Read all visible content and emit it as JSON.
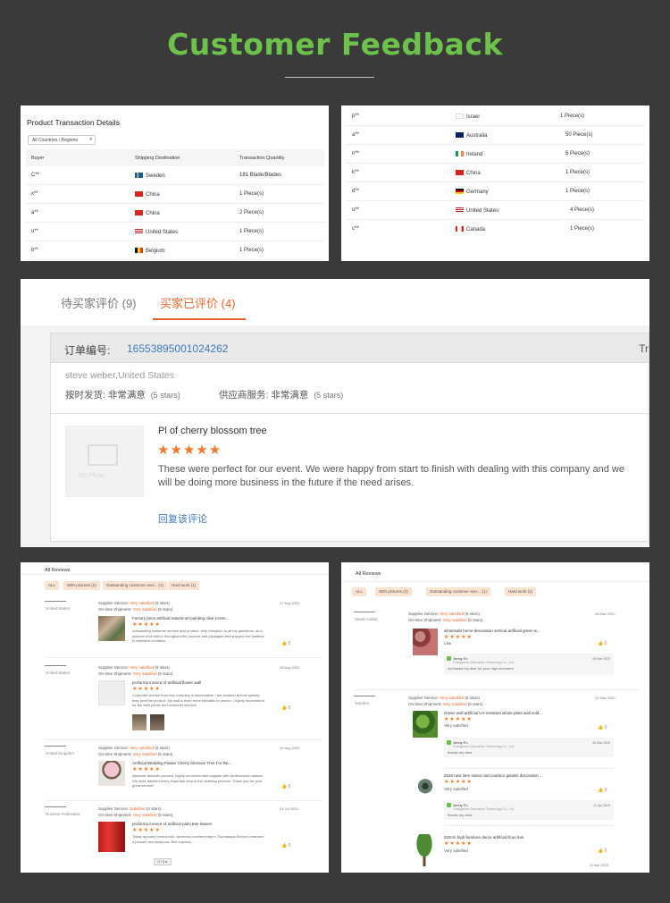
{
  "page": {
    "title": "Customer Feedback"
  },
  "transactions_left": {
    "title": "Product Transaction Details",
    "filter": "All Countries / Regions",
    "columns": [
      "Buyer",
      "Shipping Destination",
      "Transaction Quantity"
    ],
    "rows": [
      {
        "buyer": "C**",
        "country": "Sweden",
        "qty": "181 Blade/Blades"
      },
      {
        "buyer": "x**",
        "country": "China",
        "qty": "1 Piece(s)"
      },
      {
        "buyer": "a**",
        "country": "China",
        "qty": "2 Piece(s)"
      },
      {
        "buyer": "u**",
        "country": "United States",
        "qty": "1 Piece(s)"
      },
      {
        "buyer": "b**",
        "country": "Belgium",
        "qty": "1 Piece(s)"
      }
    ]
  },
  "transactions_right": {
    "rows": [
      {
        "buyer": "p**",
        "country": "Israel",
        "qty": "1 Piece(s)"
      },
      {
        "buyer": "a**",
        "country": "Australia",
        "qty": "50 Piece(s)"
      },
      {
        "buyer": "n**",
        "country": "Ireland",
        "qty": "5 Piece(s)"
      },
      {
        "buyer": "k**",
        "country": "China",
        "qty": "1 Piece(s)"
      },
      {
        "buyer": "d**",
        "country": "Germany",
        "qty": "1 Piece(s)"
      },
      {
        "buyer": "u**",
        "country": "United States",
        "qty": "4 Piece(s)"
      },
      {
        "buyer": "c**",
        "country": "Canada",
        "qty": "1 Piece(s)"
      }
    ]
  },
  "review_panel": {
    "tab_pending": "待买家评价 (9)",
    "tab_done": "买家已评价 (4)",
    "order_label": "订单编号:",
    "order_id": "16553895001024262",
    "order_right": "Tr",
    "buyer": "steve weber,United States",
    "ship_label": "按时发货: 非常满意",
    "ship_stars": "(5 stars)",
    "service_label": "供应商服务: 非常满意",
    "service_stars": "(5 stars)",
    "no_photo": "No Photo",
    "product": "Pl of cherry blossom tree",
    "stars": "★★★★★",
    "text": "These were perfect for our event. We were happy from start to finish with dealing with this company and we will be doing more business in the future if the need arises.",
    "reply_link": "回复该评论"
  },
  "reviews_left": {
    "title": "All Reviews",
    "chips": [
      "ALL",
      "With pictures (2)",
      "Outstanding customer serv... (1)",
      "Hard work (1)"
    ],
    "items": [
      {
        "user": "United States",
        "svc": "Supplier Service:",
        "svc_v": "Very satisfied",
        "svc_s": "(5 stars)",
        "ship": "On-time Shipment:",
        "ship_v": "Very satisfied",
        "ship_s": "(5 stars)",
        "date": "27 Aug 2020",
        "product": "Factory price artificial natural art painting olive Cress...",
        "stars": "★★★★★",
        "text": "outstanding customer service and product. very reception to all my questions, as in pictures and videos throughout the process and packages and shipped the material in excellent condition.",
        "likes": "0"
      },
      {
        "user": "United States",
        "svc": "Supplier Service:",
        "svc_v": "Very satisfied",
        "svc_s": "(5 stars)",
        "ship": "On-time Shipment:",
        "ship_v": "Very satisfied",
        "ship_s": "(5 stars)",
        "date": "26 Aug 2020",
        "product": "proforma invoice of artificial flower wall",
        "stars": "★★★★★",
        "text": "Customer service from this company is impeccable! I am amazed at how speedy they sent the product. My wall is even more beautiful in person. I highly recommend for the best prices and customer service!",
        "likes": "0"
      },
      {
        "user": "United Kingdom",
        "svc": "Supplier Service:",
        "svc_v": "Very satisfied",
        "svc_s": "(5 stars)",
        "ship": "On-time Shipment:",
        "ship_v": "Very satisfied",
        "ship_s": "(5 stars)",
        "date": "15 Aug 2020",
        "product": "Artificial Wedding Flower Cherry blossom Tree For Re...",
        "stars": "★★★★★",
        "text": "Absolute fantastic product, highly recommended supplier with professional manner. We were advised every important step in the ordering process. Thank you for your great service!",
        "likes": "0"
      },
      {
        "user": "Russian Federation",
        "svc": "Supplier Service:",
        "svc_v": "Satisfied",
        "svc_s": "(4 stars)",
        "ship": "On-time Shipment:",
        "ship_v": "Very satisfied",
        "ship_s": "(5 stars)",
        "date": "24 Jul 2020",
        "product": "proforma invoice of artificial palm tree leaves",
        "stars": "★★★★★",
        "text": "Товар прошел полностью, качество соответствует. Поставщик быстро отвечает и решает все вопросы. Всё хорошо.",
        "likes": "0"
      }
    ],
    "control": "0 / 0 ▸"
  },
  "reviews_right": {
    "title": "All Reviews",
    "chips": [
      "ALL",
      "With pictures (2)",
      "Outstanding customer serv... (1)",
      "Hard work (1)"
    ],
    "items": [
      {
        "user": "Saudi Arabia",
        "svc": "Supplier Service:",
        "svc_v": "Very satisfied",
        "svc_s": "(5 stars)",
        "ship": "On-time Shipment:",
        "ship_v": "Very satisfied",
        "ship_s": "(5 stars)",
        "date": "26 Mar 2020",
        "product": "wholesale home decoration vertical artificial green w...",
        "stars": "★★★★★",
        "text": "Like",
        "likes": "0",
        "reply_name": "Jenny Fu",
        "reply_company": "Guangzhou Decoration Technology Co., Ltd.",
        "reply_text": "ok,thanks my dear for your high comment",
        "reply_date": "26 Mar 2020"
      },
      {
        "user": "Sweden",
        "svc": "Supplier Service:",
        "svc_v": "Very satisfied",
        "svc_s": "(5 stars)",
        "ship": "On-time Shipment:",
        "ship_v": "Very satisfied",
        "ship_s": "(5 stars)",
        "date": "24 Mar 2020",
        "product": "Green wall artificial UV-resistant whole plant wall sold...",
        "stars": "★★★★★",
        "text": "Very satisfied",
        "likes": "0",
        "reply_name": "Jenny Fu",
        "reply_company": "Guangzhou Decoration Technology Co., Ltd.",
        "reply_text": "thanks my dear",
        "reply_date": "26 Mar 2020"
      },
      {
        "product": "2020 new item indoor and outdoor garden decoration ...",
        "stars": "★★★★★",
        "text": "Very satisfied",
        "likes": "0",
        "reply_name": "Jenny Fu",
        "reply_company": "Guangzhou Decoration Technology Co., Ltd.",
        "reply_text": "thanks my dear",
        "reply_date": "11 Apr 2020"
      },
      {
        "product": "220cm high furniture decor artificial ficus tree",
        "stars": "★★★★★",
        "text": "Very satisfied",
        "likes": "0",
        "date": "11 Apr 2020"
      }
    ]
  },
  "colors": {
    "accent": "#6cc24a",
    "orange": "#e8642c",
    "link": "#3d7bbf"
  }
}
